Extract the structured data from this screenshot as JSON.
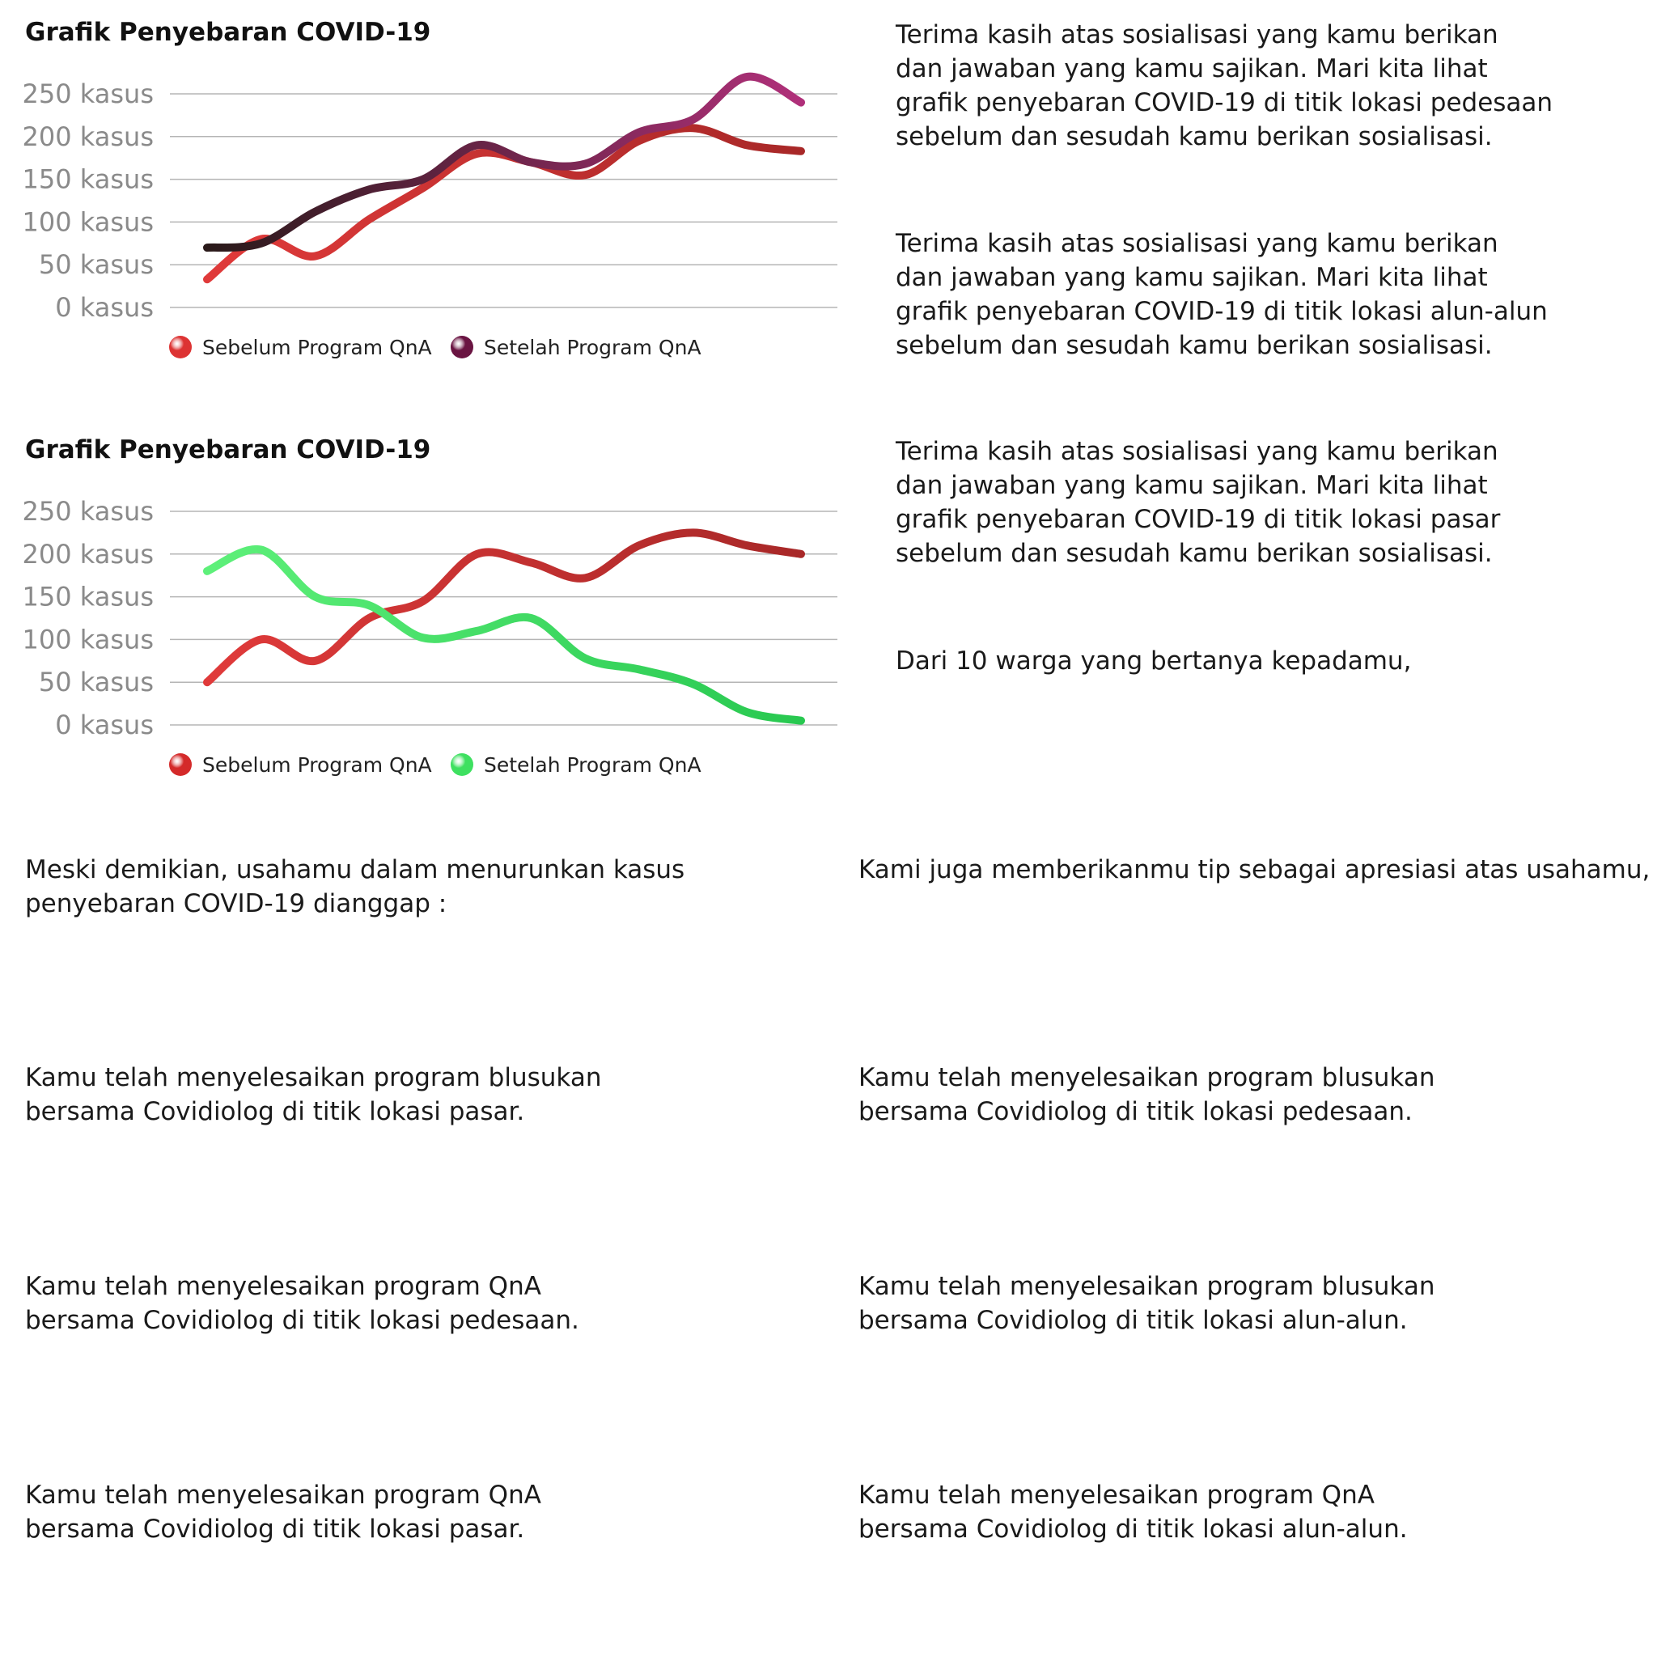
{
  "charts": [
    {
      "title": "Grafik Penyebaran COVID-19",
      "tick_labels": [
        "250 kasus",
        "200 kasus",
        "150 kasus",
        "100 kasus",
        "50 kasus",
        "0 kasus"
      ],
      "legend": [
        {
          "label": "Sebelum Program QnA",
          "color": "#dd3333"
        },
        {
          "label": "Setelah Program QnA",
          "color": "#6a1442"
        }
      ]
    },
    {
      "title": "Grafik Penyebaran COVID-19",
      "tick_labels": [
        "250 kasus",
        "200 kasus",
        "150 kasus",
        "100 kasus",
        "50 kasus",
        "0 kasus"
      ],
      "legend": [
        {
          "label": "Sebelum Program QnA",
          "color": "#d42a2a"
        },
        {
          "label": "Setelah Program QnA",
          "color": "#3ee060"
        }
      ]
    }
  ],
  "chart_data": [
    {
      "type": "line",
      "title": "Grafik Penyebaran COVID-19",
      "xlabel": "",
      "ylabel": "",
      "ylim": [
        0,
        250
      ],
      "yticks": [
        0,
        50,
        100,
        150,
        200,
        250
      ],
      "grid": true,
      "legend_position": "bottom-left",
      "series": [
        {
          "name": "Sebelum Program QnA",
          "color": "#dd3333",
          "colors": [
            "#e03a3a",
            "#a82828"
          ],
          "x": [
            0,
            1,
            2,
            3,
            4,
            5,
            6,
            7,
            8,
            9,
            10,
            11
          ],
          "values": [
            33,
            80,
            60,
            103,
            140,
            180,
            170,
            155,
            195,
            210,
            190,
            183
          ]
        },
        {
          "name": "Setelah Program QnA",
          "color": "#6a1442",
          "colors": [
            "#2a1a1a",
            "#b0307a"
          ],
          "x": [
            0,
            1,
            2,
            3,
            4,
            5,
            6,
            7,
            8,
            9,
            10,
            11
          ],
          "values": [
            70,
            75,
            112,
            138,
            150,
            190,
            170,
            168,
            205,
            220,
            270,
            240
          ]
        }
      ]
    },
    {
      "type": "line",
      "title": "Grafik Penyebaran COVID-19",
      "xlabel": "",
      "ylabel": "",
      "ylim": [
        0,
        250
      ],
      "yticks": [
        0,
        50,
        100,
        150,
        200,
        250
      ],
      "grid": true,
      "legend_position": "bottom-left",
      "series": [
        {
          "name": "Sebelum Program QnA",
          "color": "#d42a2a",
          "colors": [
            "#e03a3a",
            "#a82828"
          ],
          "x": [
            0,
            1,
            2,
            3,
            4,
            5,
            6,
            7,
            8,
            9,
            10,
            11
          ],
          "values": [
            50,
            100,
            75,
            125,
            145,
            200,
            190,
            172,
            210,
            225,
            210,
            200
          ]
        },
        {
          "name": "Setelah Program QnA",
          "color": "#3ee060",
          "colors": [
            "#5ef07a",
            "#28c850"
          ],
          "x": [
            0,
            1,
            2,
            3,
            4,
            5,
            6,
            7,
            8,
            9,
            10,
            11
          ],
          "values": [
            180,
            205,
            150,
            140,
            102,
            110,
            125,
            78,
            65,
            48,
            15,
            5
          ]
        }
      ]
    }
  ],
  "paragraphs": [
    "Terima kasih atas sosialisasi yang kamu berikan\ndan jawaban yang kamu sajikan. Mari kita lihat\ngrafik penyebaran COVID-19 di titik lokasi pedesaan\nsebelum dan sesudah kamu berikan sosialisasi.",
    "Terima kasih atas sosialisasi yang kamu berikan\ndan jawaban yang kamu sajikan. Mari kita lihat\ngrafik penyebaran COVID-19 di titik lokasi alun-alun\nsebelum dan sesudah kamu berikan sosialisasi.",
    "Terima kasih atas sosialisasi yang kamu berikan\ndan jawaban yang kamu sajikan. Mari kita lihat\ngrafik penyebaran COVID-19 di titik lokasi pasar\nsebelum dan sesudah kamu berikan sosialisasi.",
    "Dari 10 warga yang bertanya kepadamu,",
    "Meski demikian, usahamu dalam menurunkan kasus\npenyebaran COVID-19 dianggap :",
    "Kami juga memberikanmu tip sebagai apresiasi atas usahamu,",
    "Kamu telah menyelesaikan program blusukan\nbersama Covidiolog di titik lokasi pasar.",
    "Kamu telah menyelesaikan program blusukan\nbersama Covidiolog di titik lokasi pedesaan.",
    "Kamu telah menyelesaikan program QnA\nbersama Covidiolog di titik lokasi pedesaan.",
    "Kamu telah menyelesaikan program blusukan\nbersama Covidiolog di titik lokasi alun-alun.",
    "Kamu telah menyelesaikan program QnA\nbersama Covidiolog di titik lokasi pasar.",
    "Kamu telah menyelesaikan program QnA\nbersama Covidiolog di titik lokasi alun-alun."
  ]
}
